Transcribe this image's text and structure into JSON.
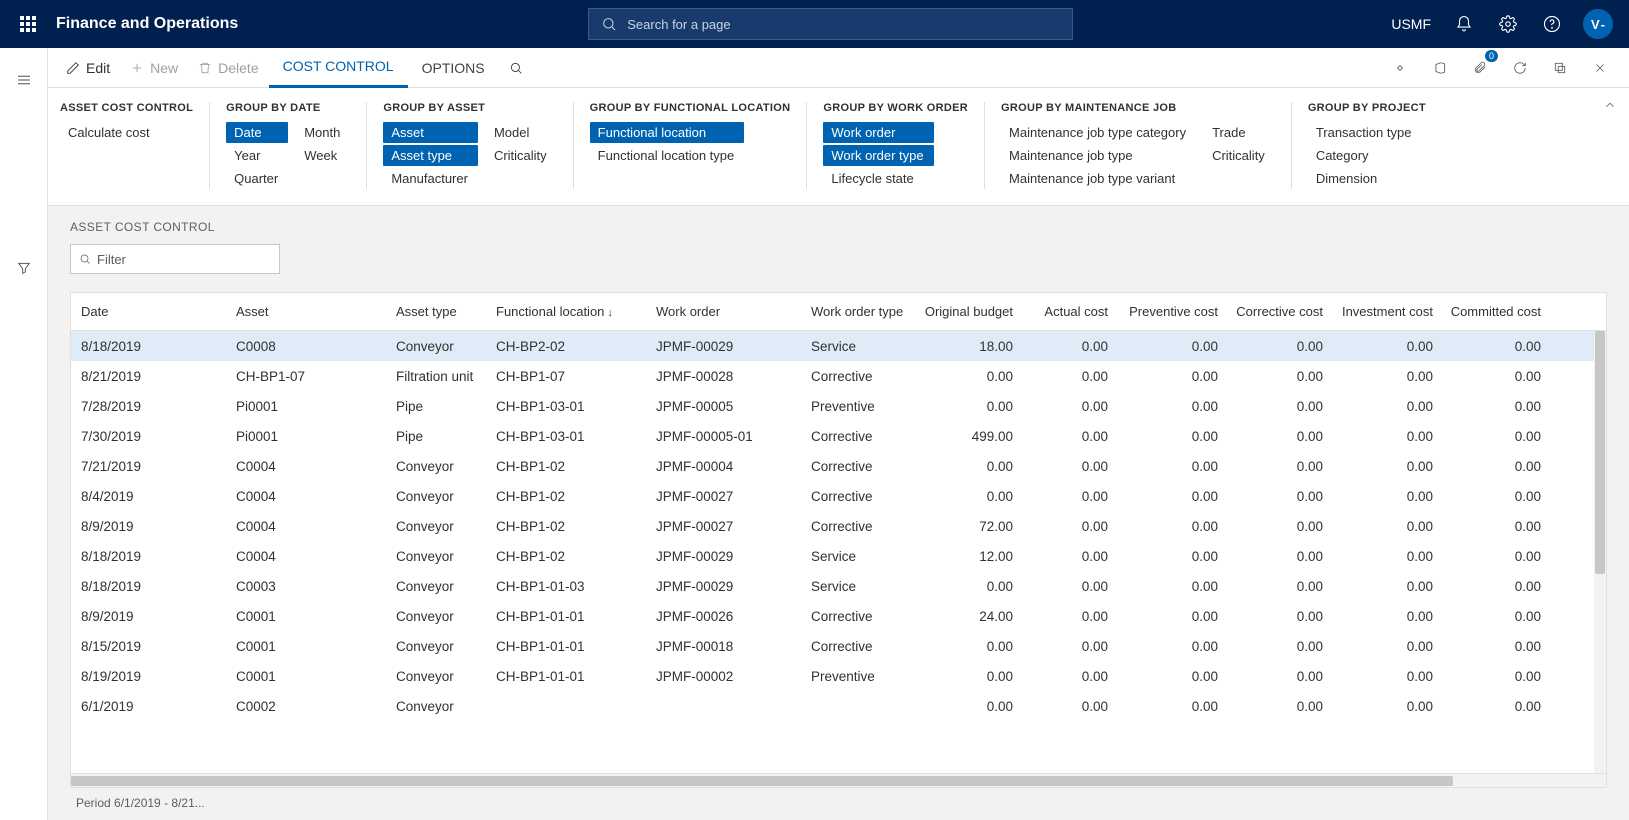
{
  "header": {
    "app_title": "Finance and Operations",
    "search_placeholder": "Search for a page",
    "company": "USMF",
    "avatar_initial": "V"
  },
  "action_bar": {
    "edit": "Edit",
    "new": "New",
    "delete": "Delete",
    "tabs": [
      "COST CONTROL",
      "OPTIONS"
    ],
    "active_tab": 0,
    "badge_count": "0"
  },
  "ribbon": {
    "groups": [
      {
        "title": "ASSET COST CONTROL",
        "cols": [
          [
            {
              "label": "Calculate cost",
              "sel": false
            }
          ]
        ]
      },
      {
        "title": "GROUP BY DATE",
        "cols": [
          [
            {
              "label": "Date",
              "sel": true
            },
            {
              "label": "Year",
              "sel": false
            },
            {
              "label": "Quarter",
              "sel": false
            }
          ],
          [
            {
              "label": "Month",
              "sel": false
            },
            {
              "label": "Week",
              "sel": false
            }
          ]
        ]
      },
      {
        "title": "GROUP BY ASSET",
        "cols": [
          [
            {
              "label": "Asset",
              "sel": true
            },
            {
              "label": "Asset type",
              "sel": true
            },
            {
              "label": "Manufacturer",
              "sel": false
            }
          ],
          [
            {
              "label": "Model",
              "sel": false
            },
            {
              "label": "Criticality",
              "sel": false
            }
          ]
        ]
      },
      {
        "title": "GROUP BY FUNCTIONAL LOCATION",
        "cols": [
          [
            {
              "label": "Functional location",
              "sel": true
            },
            {
              "label": "Functional location type",
              "sel": false
            }
          ]
        ]
      },
      {
        "title": "GROUP BY WORK ORDER",
        "cols": [
          [
            {
              "label": "Work order",
              "sel": true
            },
            {
              "label": "Work order type",
              "sel": true
            },
            {
              "label": "Lifecycle state",
              "sel": false
            }
          ]
        ]
      },
      {
        "title": "GROUP BY MAINTENANCE JOB",
        "cols": [
          [
            {
              "label": "Maintenance job type category",
              "sel": false
            },
            {
              "label": "Maintenance job type",
              "sel": false
            },
            {
              "label": "Maintenance job type variant",
              "sel": false
            }
          ],
          [
            {
              "label": "Trade",
              "sel": false
            },
            {
              "label": "Criticality",
              "sel": false
            }
          ]
        ]
      },
      {
        "title": "GROUP BY PROJECT",
        "cols": [
          [
            {
              "label": "Transaction type",
              "sel": false
            },
            {
              "label": "Category",
              "sel": false
            },
            {
              "label": "Dimension",
              "sel": false
            }
          ]
        ]
      }
    ]
  },
  "content": {
    "section_title": "ASSET COST CONTROL",
    "filter_placeholder": "Filter",
    "footer": "Period 6/1/2019 - 8/21..."
  },
  "grid": {
    "columns": [
      {
        "label": "Date",
        "num": false,
        "sorted": false
      },
      {
        "label": "Asset",
        "num": false
      },
      {
        "label": "Asset type",
        "num": false
      },
      {
        "label": "Functional location",
        "num": false,
        "sorted": true
      },
      {
        "label": "Work order",
        "num": false
      },
      {
        "label": "Work order type",
        "num": false
      },
      {
        "label": "Original budget",
        "num": true
      },
      {
        "label": "Actual cost",
        "num": true
      },
      {
        "label": "Preventive cost",
        "num": true
      },
      {
        "label": "Corrective cost",
        "num": true
      },
      {
        "label": "Investment cost",
        "num": true
      },
      {
        "label": "Committed cost",
        "num": true
      }
    ],
    "rows": [
      {
        "sel": true,
        "c": [
          "8/18/2019",
          "C0008",
          "Conveyor",
          "CH-BP2-02",
          "JPMF-00029",
          "Service",
          "18.00",
          "0.00",
          "0.00",
          "0.00",
          "0.00",
          "0.00"
        ]
      },
      {
        "c": [
          "8/21/2019",
          "CH-BP1-07",
          "Filtration unit",
          "CH-BP1-07",
          "JPMF-00028",
          "Corrective",
          "0.00",
          "0.00",
          "0.00",
          "0.00",
          "0.00",
          "0.00"
        ]
      },
      {
        "c": [
          "7/28/2019",
          "Pi0001",
          "Pipe",
          "CH-BP1-03-01",
          "JPMF-00005",
          "Preventive",
          "0.00",
          "0.00",
          "0.00",
          "0.00",
          "0.00",
          "0.00"
        ]
      },
      {
        "c": [
          "7/30/2019",
          "Pi0001",
          "Pipe",
          "CH-BP1-03-01",
          "JPMF-00005-01",
          "Corrective",
          "499.00",
          "0.00",
          "0.00",
          "0.00",
          "0.00",
          "0.00"
        ]
      },
      {
        "c": [
          "7/21/2019",
          "C0004",
          "Conveyor",
          "CH-BP1-02",
          "JPMF-00004",
          "Corrective",
          "0.00",
          "0.00",
          "0.00",
          "0.00",
          "0.00",
          "0.00"
        ]
      },
      {
        "c": [
          "8/4/2019",
          "C0004",
          "Conveyor",
          "CH-BP1-02",
          "JPMF-00027",
          "Corrective",
          "0.00",
          "0.00",
          "0.00",
          "0.00",
          "0.00",
          "0.00"
        ]
      },
      {
        "c": [
          "8/9/2019",
          "C0004",
          "Conveyor",
          "CH-BP1-02",
          "JPMF-00027",
          "Corrective",
          "72.00",
          "0.00",
          "0.00",
          "0.00",
          "0.00",
          "0.00"
        ]
      },
      {
        "c": [
          "8/18/2019",
          "C0004",
          "Conveyor",
          "CH-BP1-02",
          "JPMF-00029",
          "Service",
          "12.00",
          "0.00",
          "0.00",
          "0.00",
          "0.00",
          "0.00"
        ]
      },
      {
        "c": [
          "8/18/2019",
          "C0003",
          "Conveyor",
          "CH-BP1-01-03",
          "JPMF-00029",
          "Service",
          "0.00",
          "0.00",
          "0.00",
          "0.00",
          "0.00",
          "0.00"
        ]
      },
      {
        "c": [
          "8/9/2019",
          "C0001",
          "Conveyor",
          "CH-BP1-01-01",
          "JPMF-00026",
          "Corrective",
          "24.00",
          "0.00",
          "0.00",
          "0.00",
          "0.00",
          "0.00"
        ]
      },
      {
        "c": [
          "8/15/2019",
          "C0001",
          "Conveyor",
          "CH-BP1-01-01",
          "JPMF-00018",
          "Corrective",
          "0.00",
          "0.00",
          "0.00",
          "0.00",
          "0.00",
          "0.00"
        ]
      },
      {
        "c": [
          "8/19/2019",
          "C0001",
          "Conveyor",
          "CH-BP1-01-01",
          "JPMF-00002",
          "Preventive",
          "0.00",
          "0.00",
          "0.00",
          "0.00",
          "0.00",
          "0.00"
        ]
      },
      {
        "c": [
          "6/1/2019",
          "C0002",
          "Conveyor",
          "",
          "",
          "",
          "0.00",
          "0.00",
          "0.00",
          "0.00",
          "0.00",
          "0.00"
        ]
      }
    ]
  }
}
